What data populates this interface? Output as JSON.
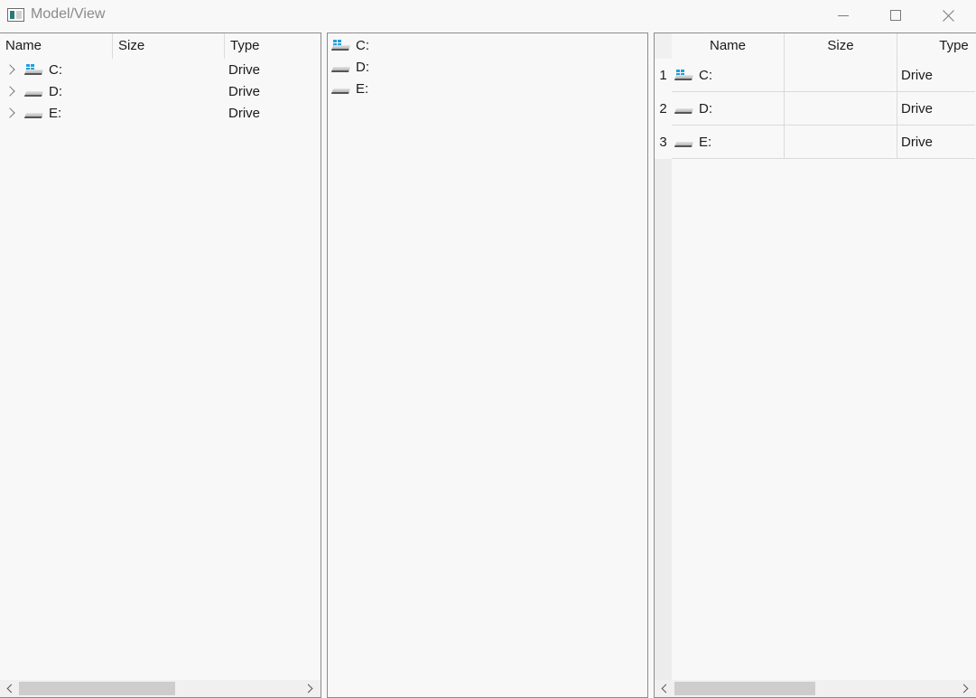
{
  "window": {
    "title": "Model/View",
    "icons": {
      "app": "app-window-icon",
      "minimize": "minimize-icon",
      "maximize": "maximize-icon",
      "close": "close-icon"
    }
  },
  "tree_view": {
    "columns": [
      "Name",
      "Size",
      "Type"
    ],
    "rows": [
      {
        "name": "C:",
        "size": "",
        "type": "Drive",
        "icon": "system-drive-icon"
      },
      {
        "name": "D:",
        "size": "",
        "type": "Drive",
        "icon": "drive-icon"
      },
      {
        "name": "E:",
        "size": "",
        "type": "Drive",
        "icon": "drive-icon"
      }
    ],
    "scroll_position": 0
  },
  "list_view": {
    "items": [
      {
        "name": "C:",
        "icon": "system-drive-icon"
      },
      {
        "name": "D:",
        "icon": "drive-icon"
      },
      {
        "name": "E:",
        "icon": "drive-icon"
      }
    ]
  },
  "table_view": {
    "columns": [
      "Name",
      "Size",
      "Type"
    ],
    "row_numbers": [
      "1",
      "2",
      "3"
    ],
    "rows": [
      {
        "name": "C:",
        "size": "",
        "type": "Drive",
        "icon": "system-drive-icon"
      },
      {
        "name": "D:",
        "size": "",
        "type": "Drive",
        "icon": "drive-icon"
      },
      {
        "name": "E:",
        "size": "",
        "type": "Drive",
        "icon": "drive-icon"
      }
    ],
    "scroll_position": 0
  },
  "colors": {
    "windows_logo": "#1ea0e0",
    "background": "#f8f8f8",
    "border": "#8c8c8c"
  }
}
